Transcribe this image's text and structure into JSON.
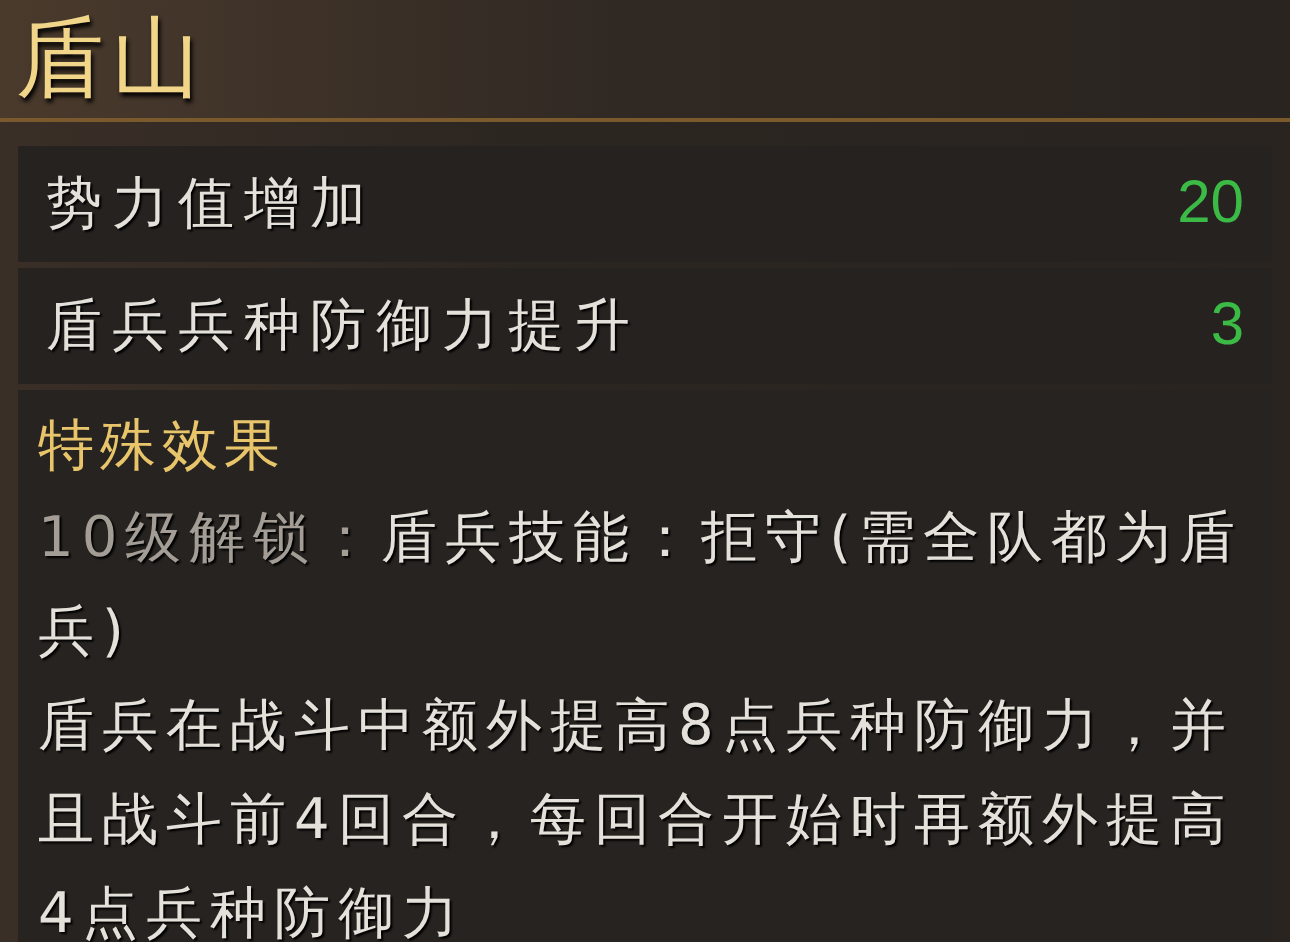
{
  "title": "盾山",
  "stats": [
    {
      "label": "势力值增加",
      "value": "20"
    },
    {
      "label": "盾兵兵种防御力提升",
      "value": "3"
    }
  ],
  "special": {
    "heading": "特殊效果",
    "unlock_level": "10级解锁：",
    "unlock_text": "盾兵技能：拒守(需全队都为盾兵)",
    "description": "盾兵在战斗中额外提高8点兵种防御力，并且战斗前4回合，每回合开始时再额外提高4点兵种防御力"
  }
}
